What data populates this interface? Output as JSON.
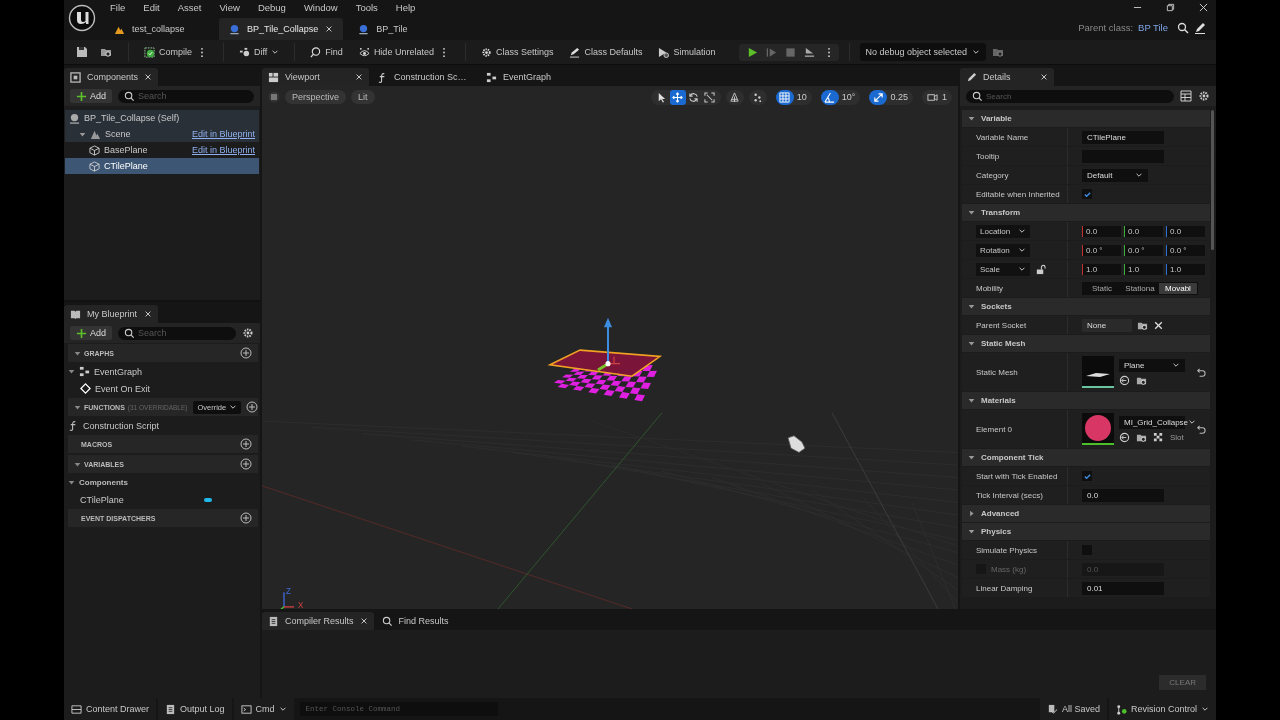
{
  "window": {
    "menu": [
      "File",
      "Edit",
      "Asset",
      "View",
      "Debug",
      "Window",
      "Tools",
      "Help"
    ],
    "parent_class_label": "Parent class:",
    "parent_class": "BP Tile"
  },
  "doc_tabs": [
    {
      "label": "test_collapse",
      "kind": "level",
      "selected": false
    },
    {
      "label": "BP_Tile_Collapse",
      "kind": "blueprint",
      "selected": true
    },
    {
      "label": "BP_Tile",
      "kind": "blueprint",
      "selected": false
    }
  ],
  "toolbar": {
    "buttons": [
      {
        "kind": "compile",
        "label": "Compile",
        "dropdown": false,
        "options": true
      },
      {
        "kind": "diff",
        "label": "Diff",
        "dropdown": true,
        "options": false
      },
      {
        "kind": "find",
        "label": "Find",
        "dropdown": false,
        "options": false
      },
      {
        "kind": "hide",
        "label": "Hide Unrelated",
        "dropdown": false,
        "options": true
      },
      {
        "kind": "settings",
        "label": "Class Settings",
        "dropdown": false,
        "options": false
      },
      {
        "kind": "defaults",
        "label": "Class Defaults",
        "dropdown": false,
        "options": false
      },
      {
        "kind": "simulation",
        "label": "Simulation",
        "dropdown": false,
        "options": false
      }
    ],
    "debug_object": "No debug object selected"
  },
  "components": {
    "title": "Components",
    "add_label": "Add",
    "search_placeholder": "Search",
    "tree": [
      {
        "label": "BP_Tile_Collapse (Self)",
        "kind": "actor",
        "selected": false,
        "children": [
          {
            "label": "Scene",
            "kind": "scene",
            "link": "Edit in Blueprint",
            "selected": false,
            "children": [
              {
                "label": "BasePlane",
                "kind": "mesh",
                "link": "Edit in Blueprint",
                "selected": false
              },
              {
                "label": "CTilePlane",
                "kind": "mesh",
                "selected": true
              }
            ]
          }
        ]
      }
    ]
  },
  "my_blueprint": {
    "title": "My Blueprint",
    "add_label": "Add",
    "search_placeholder": "Search",
    "sections": [
      {
        "title": "GRAPHS",
        "expanded": true,
        "items": [
          {
            "label": "EventGraph",
            "kind": "graph",
            "children": [
              {
                "label": "Event On Exit",
                "kind": "event"
              }
            ]
          }
        ]
      },
      {
        "title": "FUNCTIONS",
        "note": "(31 OVERRIDABLE)",
        "dropdown": "Override",
        "expanded": true,
        "items": [
          {
            "label": "Construction Script",
            "kind": "function"
          }
        ]
      },
      {
        "title": "MACROS",
        "expanded": false
      },
      {
        "title": "VARIABLES",
        "expanded": true,
        "items": [
          {
            "label": "Components",
            "kind": "category",
            "children": [
              {
                "label": "CTilePlane",
                "kind": "variable",
                "color": "#1fb8e8"
              }
            ]
          }
        ]
      },
      {
        "title": "EVENT DISPATCHERS",
        "expanded": false
      }
    ]
  },
  "editor_tabs": [
    {
      "label": "Viewport",
      "kind": "viewport",
      "selected": true
    },
    {
      "label": "Construction Sc…",
      "kind": "function",
      "selected": false
    },
    {
      "label": "EventGraph",
      "kind": "graph",
      "selected": false
    }
  ],
  "viewport": {
    "view_mode": "Perspective",
    "lighting": "Lit",
    "transform_tools": [
      {
        "kind": "select",
        "selected": false
      },
      {
        "kind": "translate",
        "selected": true
      },
      {
        "kind": "rotate",
        "selected": false
      },
      {
        "kind": "scale",
        "selected": false
      }
    ],
    "snaps": [
      {
        "kind": "grid",
        "on": true,
        "value": "10"
      },
      {
        "kind": "angle",
        "on": true,
        "value": "10°"
      },
      {
        "kind": "scale",
        "on": true,
        "value": "0.25"
      }
    ],
    "camera_speed": "1",
    "axis_labels": [
      "Z",
      "X"
    ]
  },
  "details": {
    "title": "Details",
    "search_placeholder": "Search",
    "sections": [
      {
        "title": "Variable",
        "expanded": true,
        "rows": [
          {
            "kind": "text",
            "label": "Variable Name",
            "value": "CTilePlane"
          },
          {
            "kind": "text",
            "label": "Tooltip"
          },
          {
            "kind": "combo",
            "label": "Category",
            "value": "Default"
          },
          {
            "kind": "check",
            "label": "Editable when Inherited",
            "checked": true
          }
        ]
      },
      {
        "title": "Transform",
        "expanded": true,
        "rows": [
          {
            "kind": "vector",
            "label": "Location",
            "values": [
              "0.0",
              "0.0",
              "0.0"
            ]
          },
          {
            "kind": "vector",
            "label": "Rotation",
            "values": [
              "0.0 °",
              "0.0 °",
              "0.0 °"
            ]
          },
          {
            "kind": "scale",
            "label": "Scale",
            "values": [
              "1.0",
              "1.0",
              "1.0"
            ]
          },
          {
            "kind": "segmented",
            "label": "Mobility",
            "options": [
              {
                "label": "Static",
                "selected": false
              },
              {
                "label": "Stationa",
                "selected": false
              },
              {
                "label": "Movabl",
                "selected": true
              }
            ]
          }
        ]
      },
      {
        "title": "Sockets",
        "expanded": true,
        "rows": [
          {
            "kind": "socket",
            "label": "Parent Socket",
            "value": "None"
          }
        ]
      },
      {
        "title": "Static Mesh",
        "expanded": true,
        "rows": [
          {
            "kind": "mesh",
            "label": "Static Mesh",
            "value": "Plane"
          }
        ]
      },
      {
        "title": "Materials",
        "expanded": true,
        "rows": [
          {
            "kind": "material",
            "label": "Element 0",
            "value": "MI_Grid_Collapse",
            "extra": "Slot"
          }
        ]
      },
      {
        "title": "Component Tick",
        "expanded": true,
        "rows": [
          {
            "kind": "check",
            "label": "Start with Tick Enabled",
            "checked": true
          },
          {
            "kind": "text",
            "label": "Tick Interval (secs)",
            "value": "0.0"
          }
        ]
      },
      {
        "title": "Advanced",
        "expanded": false
      },
      {
        "title": "Physics",
        "expanded": true,
        "rows": [
          {
            "kind": "check",
            "label": "Simulate Physics",
            "checked": false
          },
          {
            "kind": "disabled",
            "label": "Mass (kg)",
            "value": "0.0",
            "checked": false
          },
          {
            "kind": "text",
            "label": "Linear Damping",
            "value": "0.01"
          }
        ]
      }
    ]
  },
  "bottom_tabs": [
    {
      "label": "Compiler Results",
      "selected": true
    },
    {
      "label": "Find Results",
      "selected": false
    }
  ],
  "clear_label": "CLEAR",
  "status_bar": {
    "content_drawer": "Content Drawer",
    "output_log": "Output Log",
    "cmd": "Cmd",
    "console_placeholder": "Enter Console Command",
    "saved": "All Saved",
    "revision": "Revision Control"
  }
}
